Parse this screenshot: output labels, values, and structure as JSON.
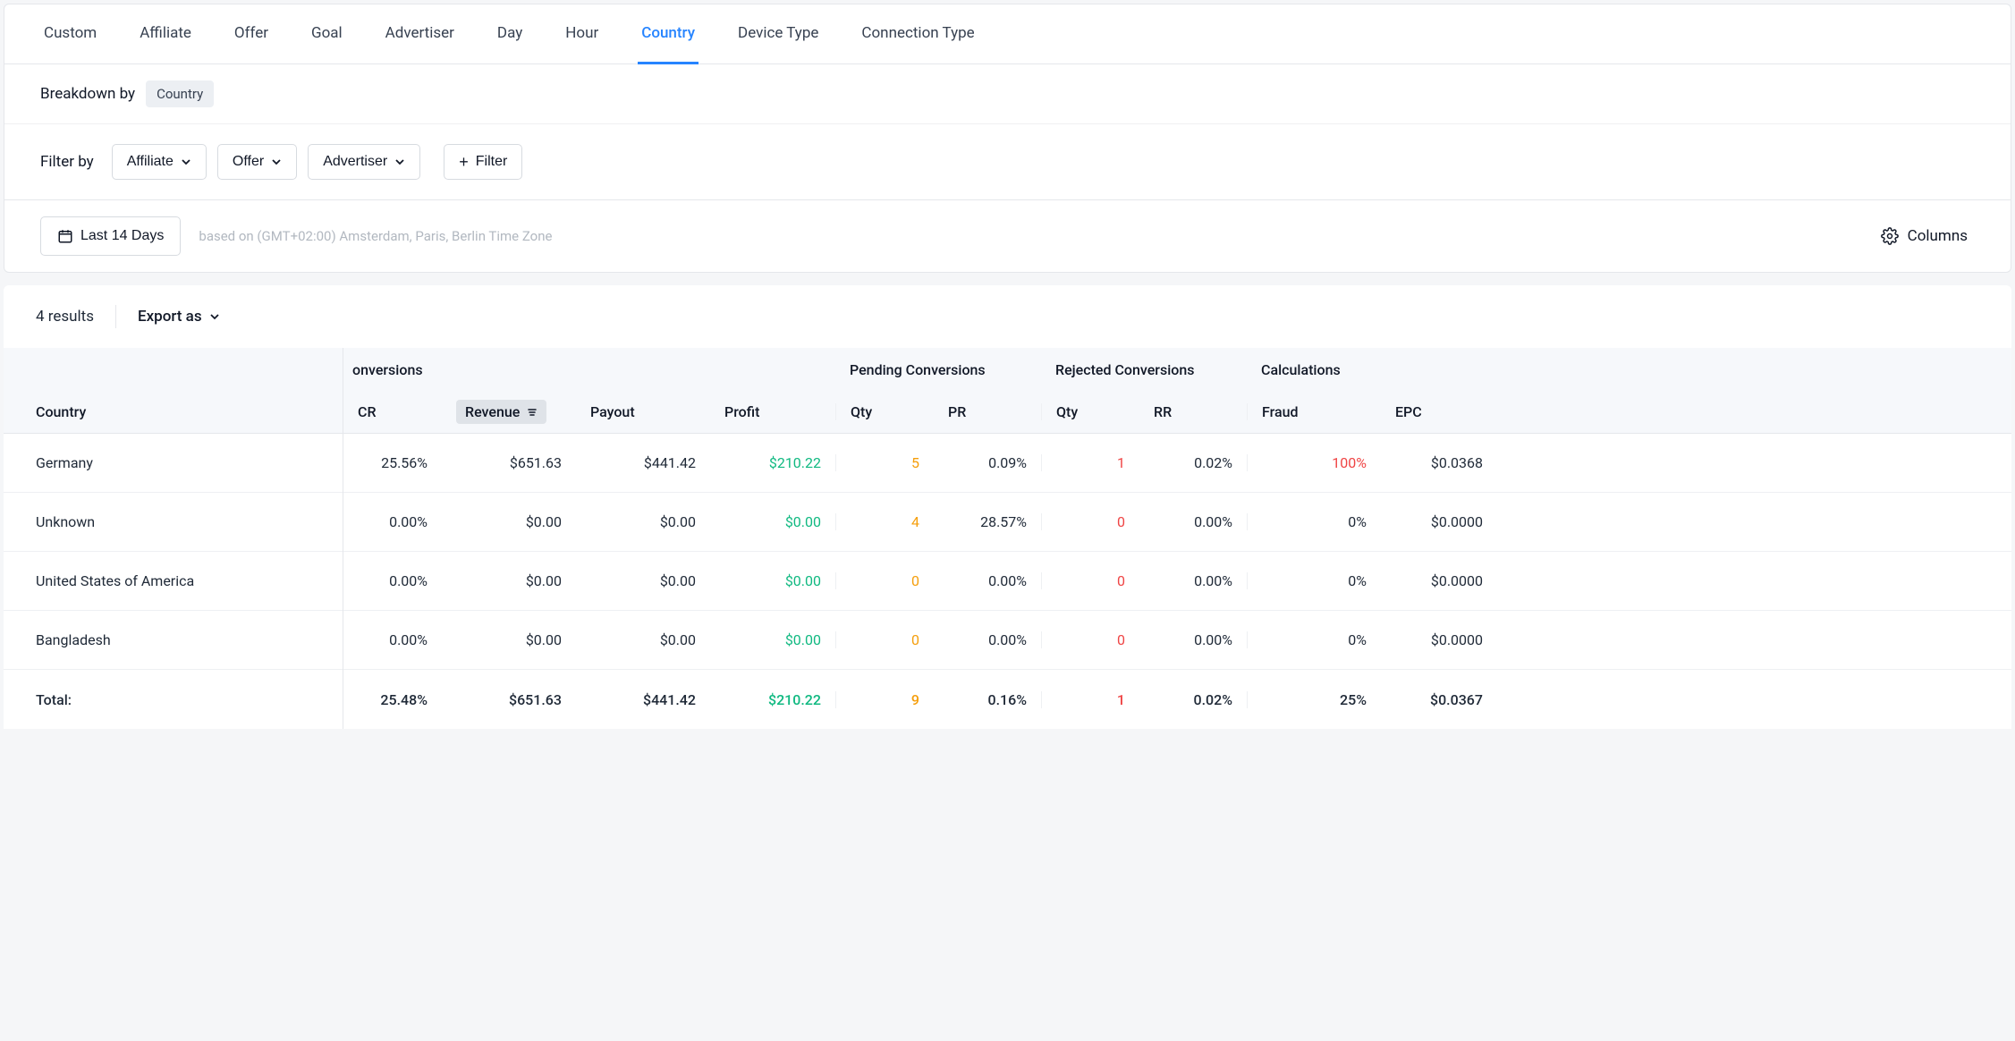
{
  "tabs": [
    "Custom",
    "Affiliate",
    "Offer",
    "Goal",
    "Advertiser",
    "Day",
    "Hour",
    "Country",
    "Device Type",
    "Connection Type"
  ],
  "active_tab_index": 7,
  "breakdown": {
    "label": "Breakdown by",
    "value": "Country"
  },
  "filter": {
    "label": "Filter by",
    "dropdowns": [
      "Affiliate",
      "Offer",
      "Advertiser"
    ],
    "add_label": "Filter"
  },
  "date": {
    "range_label": "Last 14 Days",
    "tz_note": "based on (GMT+02:00) Amsterdam, Paris, Berlin Time Zone"
  },
  "columns_button": "Columns",
  "results": {
    "count_label": "4 results",
    "export_label": "Export as"
  },
  "table": {
    "fixed_column_header": "Country",
    "group_headers": {
      "approved": "onversions",
      "pending": "Pending Conversions",
      "rejected": "Rejected Conversions",
      "calc": "Calculations"
    },
    "column_headers": {
      "cr": "CR",
      "revenue": "Revenue",
      "payout": "Payout",
      "profit": "Profit",
      "pqty": "Qty",
      "pr": "PR",
      "rqty": "Qty",
      "rr": "RR",
      "fraud": "Fraud",
      "epc": "EPC"
    },
    "sorted_column": "revenue",
    "rows": [
      {
        "country": "Germany",
        "cr": "25.56%",
        "revenue": "$651.63",
        "payout": "$441.42",
        "profit": "$210.22",
        "pqty": "5",
        "pr": "0.09%",
        "rqty": "1",
        "rr": "0.02%",
        "fraud": "100%",
        "fraud_color": "red",
        "epc": "$0.0368"
      },
      {
        "country": "Unknown",
        "cr": "0.00%",
        "revenue": "$0.00",
        "payout": "$0.00",
        "profit": "$0.00",
        "pqty": "4",
        "pr": "28.57%",
        "rqty": "0",
        "rr": "0.00%",
        "fraud": "0%",
        "fraud_color": "",
        "epc": "$0.0000"
      },
      {
        "country": "United States of America",
        "cr": "0.00%",
        "revenue": "$0.00",
        "payout": "$0.00",
        "profit": "$0.00",
        "pqty": "0",
        "pr": "0.00%",
        "rqty": "0",
        "rr": "0.00%",
        "fraud": "0%",
        "fraud_color": "",
        "epc": "$0.0000"
      },
      {
        "country": "Bangladesh",
        "cr": "0.00%",
        "revenue": "$0.00",
        "payout": "$0.00",
        "profit": "$0.00",
        "pqty": "0",
        "pr": "0.00%",
        "rqty": "0",
        "rr": "0.00%",
        "fraud": "0%",
        "fraud_color": "",
        "epc": "$0.0000"
      }
    ],
    "total": {
      "label": "Total:",
      "cr": "25.48%",
      "revenue": "$651.63",
      "payout": "$441.42",
      "profit": "$210.22",
      "pqty": "9",
      "pr": "0.16%",
      "rqty": "1",
      "rr": "0.02%",
      "fraud": "25%",
      "epc": "$0.0367"
    }
  }
}
